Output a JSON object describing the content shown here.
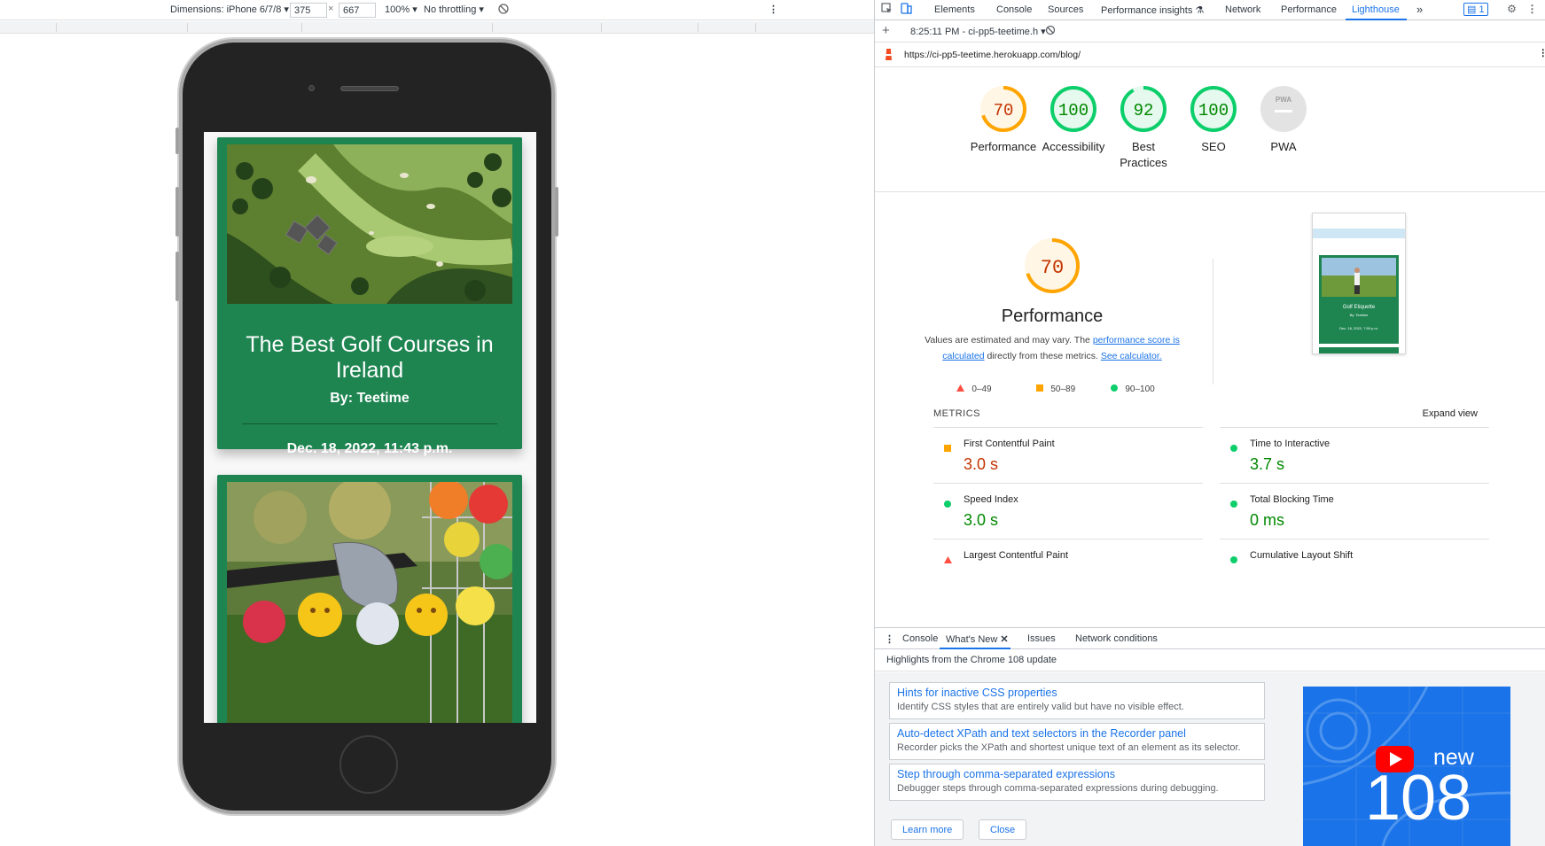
{
  "device_toolbar": {
    "dimensions_label": "Dimensions: iPhone 6/7/8",
    "width": "375",
    "x": "×",
    "height": "667",
    "zoom": "100%",
    "throttling": "No throttling"
  },
  "blog_preview": {
    "posts": [
      {
        "title": "The Best Golf Courses in Ireland",
        "author": "By: Teetime",
        "date": "Dec. 18, 2022, 11:43 p.m."
      }
    ]
  },
  "devtools": {
    "tabs": [
      "Elements",
      "Console",
      "Sources",
      "Performance insights",
      "Network",
      "Performance",
      "Lighthouse"
    ],
    "active_tab": "Lighthouse",
    "more_tabs": "»",
    "issues_count": "1",
    "report_time": "8:25:11 PM - ci-pp5-teetime.h",
    "url": "https://ci-pp5-teetime.herokuapp.com/blog/"
  },
  "lighthouse": {
    "gauges": [
      {
        "label": "Performance",
        "score": "70",
        "value": 70,
        "status": "average"
      },
      {
        "label": "Accessibility",
        "score": "100",
        "value": 100,
        "status": "pass"
      },
      {
        "label": "Best Practices",
        "score": "92",
        "value": 92,
        "status": "pass"
      },
      {
        "label": "SEO",
        "score": "100",
        "value": 100,
        "status": "pass"
      },
      {
        "label": "PWA",
        "score": "PWA",
        "value": 0,
        "status": "na"
      }
    ],
    "perf_big": {
      "score": "70",
      "label": "Performance",
      "desc_pre": "Values are estimated and may vary. The ",
      "desc_link1": "performance score is calculated",
      "desc_mid": " directly from these metrics. ",
      "desc_link2": "See calculator."
    },
    "legend": {
      "fail": "0–49",
      "average": "50–89",
      "pass": "90–100"
    },
    "thumb": {
      "title": "Golf Etiquette",
      "author": "By: Teetime",
      "date": "Dec. 18, 2022, 7:59 p.m."
    },
    "metrics_title": "METRICS",
    "expand_view": "Expand view",
    "metrics": [
      {
        "name": "First Contentful Paint",
        "value": "3.0 s",
        "status": "average"
      },
      {
        "name": "Time to Interactive",
        "value": "3.7 s",
        "status": "pass"
      },
      {
        "name": "Speed Index",
        "value": "3.0 s",
        "status": "pass"
      },
      {
        "name": "Total Blocking Time",
        "value": "0 ms",
        "status": "pass"
      },
      {
        "name": "Largest Contentful Paint",
        "value": "",
        "status": "fail"
      },
      {
        "name": "Cumulative Layout Shift",
        "value": "",
        "status": "pass"
      }
    ]
  },
  "drawer": {
    "tabs": [
      "Console",
      "What's New",
      "Issues",
      "Network conditions"
    ],
    "active_tab": "What's New",
    "header": "Highlights from the Chrome 108 update",
    "highlights": [
      {
        "title": "Hints for inactive CSS properties",
        "desc": "Identify CSS styles that are entirely valid but have no visible effect."
      },
      {
        "title": "Auto-detect XPath and text selectors in the Recorder panel",
        "desc": "Recorder picks the XPath and shortest unique text of an element as its selector."
      },
      {
        "title": "Step through comma-separated expressions",
        "desc": "Debugger steps through comma-separated expressions during debugging."
      }
    ],
    "learn_more": "Learn more",
    "close": "Close",
    "promo_new": "new",
    "promo_version": "108"
  },
  "colors": {
    "brand_green": "#1e8551",
    "pass": "#0cce6b",
    "pass_text": "#008800",
    "average": "#ffa400",
    "average_text": "#c33300",
    "fail": "#ff4e42",
    "link": "#1a73e8"
  }
}
